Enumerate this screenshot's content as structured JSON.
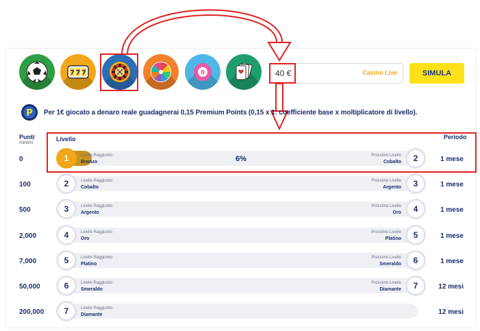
{
  "amount": {
    "value": "40 €",
    "game_label": "Casino Live"
  },
  "simula_label": "SIMULA",
  "info": "Per 1€ giocato a denaro reale guadagnerai 0,15 Premium Points (0,15 x 1: coefficiente base x moltiplicatore di livello).",
  "headers": {
    "points": "Punti",
    "points_sub": "minimi",
    "level": "Livello",
    "period": "Periodo"
  },
  "current_progress": {
    "percent": "6%",
    "fraction": 0.06
  },
  "rows": [
    {
      "points": "0",
      "level_num": "1",
      "reached_label": "Livello Raggiunto",
      "reached_name": "Bronzo",
      "next_label": "Prossimo Livello",
      "next_name": "Cobalto",
      "next_num": "2",
      "period": "1 mese"
    },
    {
      "points": "100",
      "level_num": "2",
      "reached_label": "Livello Raggiunto",
      "reached_name": "Cobalto",
      "next_label": "Prossimo Livello",
      "next_name": "Argento",
      "next_num": "3",
      "period": "1 mese"
    },
    {
      "points": "500",
      "level_num": "3",
      "reached_label": "Livello Raggiunto",
      "reached_name": "Argento",
      "next_label": "Prossimo Livello",
      "next_name": "Oro",
      "next_num": "4",
      "period": "1 mese"
    },
    {
      "points": "2,000",
      "level_num": "4",
      "reached_label": "Livello Raggiunto",
      "reached_name": "Oro",
      "next_label": "Prossimo Livello",
      "next_name": "Platino",
      "next_num": "5",
      "period": "1 mese"
    },
    {
      "points": "7,000",
      "level_num": "5",
      "reached_label": "Livello Raggiunto",
      "reached_name": "Platino",
      "next_label": "Prossimo Livello",
      "next_name": "Smeraldo",
      "next_num": "6",
      "period": "1 mese"
    },
    {
      "points": "50,000",
      "level_num": "6",
      "reached_label": "Livello Raggiunto",
      "reached_name": "Smeraldo",
      "next_label": "Prossimo Livello",
      "next_name": "Diamante",
      "next_num": "7",
      "period": "12 mesi"
    },
    {
      "points": "200,000",
      "level_num": "7",
      "reached_label": "Livello Raggiunto",
      "reached_name": "Diamante",
      "period": "12 mesi"
    }
  ],
  "game_icons": [
    "football-icon",
    "slot-777-icon",
    "roulette-icon",
    "wheel-of-fortune-icon",
    "bingo-ball-icon",
    "playing-cards-icon"
  ],
  "colors": {
    "accent_yellow": "#ffe11a",
    "navy": "#1a2d6b",
    "active_level": "#f2a61a",
    "highlight_red": "#e02020"
  }
}
